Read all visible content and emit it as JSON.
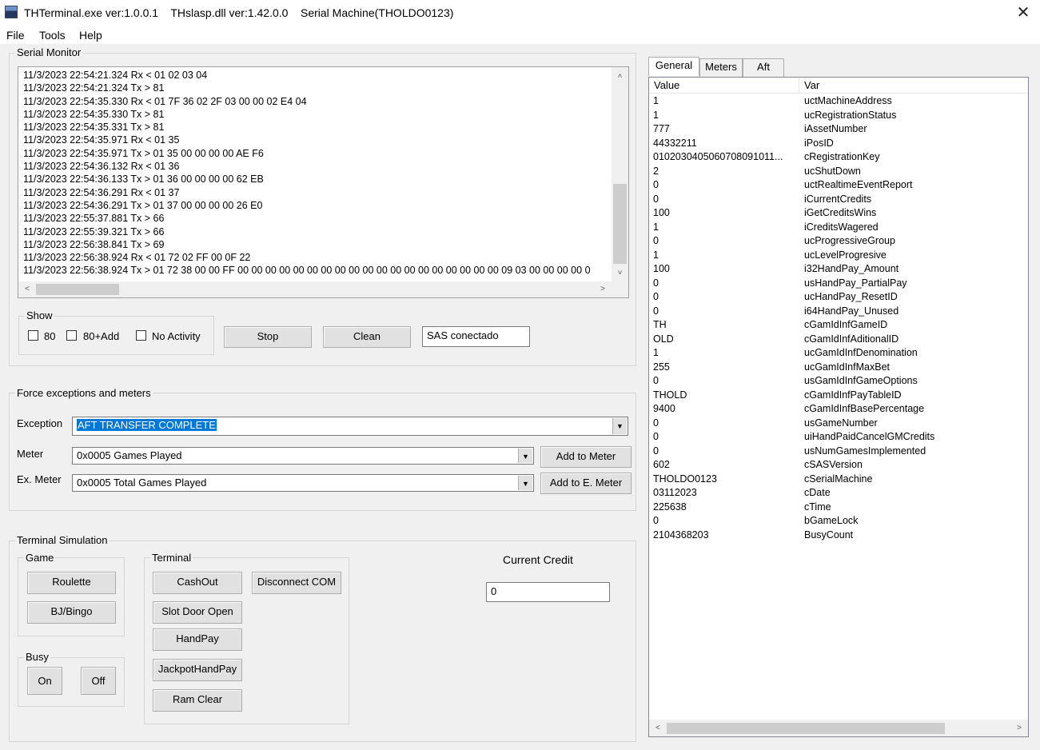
{
  "window": {
    "title": "THTerminal.exe ver:1.0.0.1    THslasp.dll ver:1.42.0.0    Serial Machine(THOLDO0123)",
    "close": "✕"
  },
  "menu": [
    "File",
    "Tools",
    "Help"
  ],
  "serial_monitor": {
    "label": "Serial Monitor",
    "lines": [
      "11/3/2023 22:54:21.324 Rx < 01 02 03 04",
      "11/3/2023 22:54:21.324 Tx > 81",
      "11/3/2023 22:54:35.330 Rx < 01 7F 36 02 2F 03 00 00 02 E4 04",
      "11/3/2023 22:54:35.330 Tx > 81",
      "11/3/2023 22:54:35.331 Tx > 81",
      "11/3/2023 22:54:35.971 Rx < 01 35",
      "11/3/2023 22:54:35.971 Tx > 01 35 00 00 00 00 AE F6",
      "11/3/2023 22:54:36.132 Rx < 01 36",
      "11/3/2023 22:54:36.133 Tx > 01 36 00 00 00 00 62 EB",
      "11/3/2023 22:54:36.291 Rx < 01 37",
      "11/3/2023 22:54:36.291 Tx > 01 37 00 00 00 00 26 E0",
      "11/3/2023 22:55:37.881 Tx > 66",
      "11/3/2023 22:55:39.321 Tx > 66",
      "11/3/2023 22:56:38.841 Tx > 69",
      "11/3/2023 22:56:38.924 Rx < 01 72 02 FF 00 0F 22",
      "11/3/2023 22:56:38.924 Tx > 01 72 38 00 00 FF 00 00 00 00 00 00 00 00 00 00 00 00 00 00 00 00 00 00 00 09 03 00 00 00 00 0"
    ],
    "show_label": "Show",
    "checkboxes": [
      "80",
      "80+Add",
      "No Activity"
    ],
    "stop": "Stop",
    "clean": "Clean",
    "status": "SAS conectado"
  },
  "force": {
    "label": "Force exceptions and meters",
    "exception_label": "Exception",
    "exception_value": "AFT TRANSFER COMPLETE",
    "meter_label": "Meter",
    "meter_value": "0x0005 Games Played",
    "add_meter": "Add to Meter",
    "exmeter_label": "Ex. Meter",
    "exmeter_value": "0x0005 Total Games Played",
    "add_emeter": "Add to E. Meter"
  },
  "terminal_sim": {
    "label": "Terminal  Simulation",
    "game_label": "Game",
    "roulette": "Roulette",
    "bjbingo": "BJ/Bingo",
    "busy_label": "Busy",
    "on": "On",
    "off": "Off",
    "terminal_label": "Terminal",
    "cashout": "CashOut",
    "disconnect": "Disconnect COM",
    "slot_door": "Slot Door Open",
    "handpay": "HandPay",
    "jackpot": "JackpotHandPay",
    "ram_clear": "Ram Clear",
    "credit_label": "Current Credit",
    "credit_value": "0"
  },
  "tabs": [
    "General",
    "Meters",
    "Aft"
  ],
  "list": {
    "col_value": "Value",
    "col_var": "Var",
    "rows": [
      [
        "1",
        "uctMachineAddress"
      ],
      [
        "1",
        "ucRegistrationStatus"
      ],
      [
        "777",
        "iAssetNumber"
      ],
      [
        "44332211",
        "iPosID"
      ],
      [
        "0102030405060708091011...",
        "cRegistrationKey"
      ],
      [
        "2",
        "ucShutDown"
      ],
      [
        "0",
        "uctRealtimeEventReport"
      ],
      [
        "0",
        "iCurrentCredits"
      ],
      [
        "100",
        "iGetCreditsWins"
      ],
      [
        "1",
        "iCreditsWagered"
      ],
      [
        "0",
        "ucProgressiveGroup"
      ],
      [
        "1",
        "ucLevelProgresive"
      ],
      [
        "100",
        "i32HandPay_Amount"
      ],
      [
        "0",
        "usHandPay_PartialPay"
      ],
      [
        "0",
        "ucHandPay_ResetID"
      ],
      [
        "0",
        "i64HandPay_Unused"
      ],
      [
        "TH",
        "cGamIdInfGameID"
      ],
      [
        "OLD",
        "cGamIdInfAditionalID"
      ],
      [
        "1",
        "ucGamIdInfDenomination"
      ],
      [
        "255",
        "ucGamIdInfMaxBet"
      ],
      [
        "0",
        "usGamIdInfGameOptions"
      ],
      [
        "THOLD",
        "cGamIdInfPayTableID"
      ],
      [
        "9400",
        "cGamIdInfBasePercentage"
      ],
      [
        "0",
        "usGameNumber"
      ],
      [
        "0",
        "uiHandPaidCancelGMCredits"
      ],
      [
        "0",
        "usNumGamesImplemented"
      ],
      [
        "602",
        "cSASVersion"
      ],
      [
        "THOLDO0123",
        "cSerialMachine"
      ],
      [
        "03112023",
        "cDate"
      ],
      [
        "225638",
        "cTime"
      ],
      [
        "0",
        "bGameLock"
      ],
      [
        "2104368203",
        "BusyCount"
      ]
    ]
  },
  "icons": {
    "up": "˄",
    "down": "˅",
    "left": "<",
    "right": ">",
    "dropdown": "▼"
  }
}
